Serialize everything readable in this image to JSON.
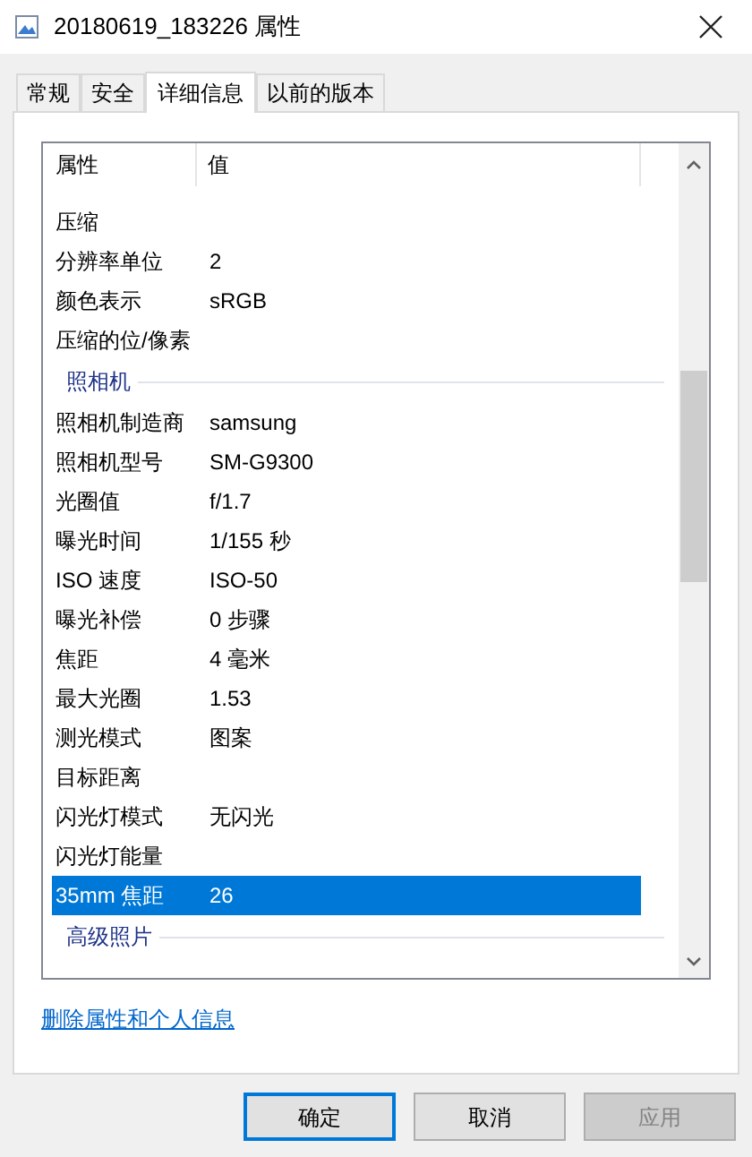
{
  "window": {
    "title": "20180619_183226 属性"
  },
  "tabs": [
    {
      "label": "常规",
      "selected": false
    },
    {
      "label": "安全",
      "selected": false
    },
    {
      "label": "详细信息",
      "selected": true
    },
    {
      "label": "以前的版本",
      "selected": false
    }
  ],
  "table": {
    "columns": [
      "属性",
      "值"
    ],
    "rows": [
      {
        "kind": "row",
        "name": "压缩",
        "selected": false
      },
      {
        "kind": "row",
        "name": "分辨率单位",
        "value": "2",
        "selected": false
      },
      {
        "kind": "row",
        "name": "颜色表示",
        "value": "sRGB",
        "selected": false
      },
      {
        "kind": "row",
        "name": "压缩的位/像素",
        "selected": false
      },
      {
        "kind": "section",
        "name": "照相机"
      },
      {
        "kind": "row",
        "name": "照相机制造商",
        "value": "samsung",
        "selected": false
      },
      {
        "kind": "row",
        "name": "照相机型号",
        "value": "SM-G9300",
        "selected": false
      },
      {
        "kind": "row",
        "name": "光圈值",
        "value": "f/1.7",
        "selected": false
      },
      {
        "kind": "row",
        "name": "曝光时间",
        "value": "1/155 秒",
        "selected": false
      },
      {
        "kind": "row",
        "name": "ISO 速度",
        "value": "ISO-50",
        "selected": false
      },
      {
        "kind": "row",
        "name": "曝光补偿",
        "value": "0 步骤",
        "selected": false
      },
      {
        "kind": "row",
        "name": "焦距",
        "value": "4 毫米",
        "selected": false
      },
      {
        "kind": "row",
        "name": "最大光圈",
        "value": "1.53",
        "selected": false
      },
      {
        "kind": "row",
        "name": "测光模式",
        "value": "图案",
        "selected": false
      },
      {
        "kind": "row",
        "name": "目标距离",
        "selected": false
      },
      {
        "kind": "row",
        "name": "闪光灯模式",
        "value": "无闪光",
        "selected": false
      },
      {
        "kind": "row",
        "name": "闪光灯能量",
        "selected": false
      },
      {
        "kind": "row",
        "name": "35mm 焦距",
        "value": "26",
        "selected": true
      },
      {
        "kind": "section",
        "name": "高级照片"
      }
    ]
  },
  "link": "删除属性和个人信息",
  "buttons": [
    {
      "label": "确定",
      "default": true,
      "disabled": false
    },
    {
      "label": "取消",
      "default": false,
      "disabled": false
    },
    {
      "label": "应用",
      "default": false,
      "disabled": true
    }
  ]
}
